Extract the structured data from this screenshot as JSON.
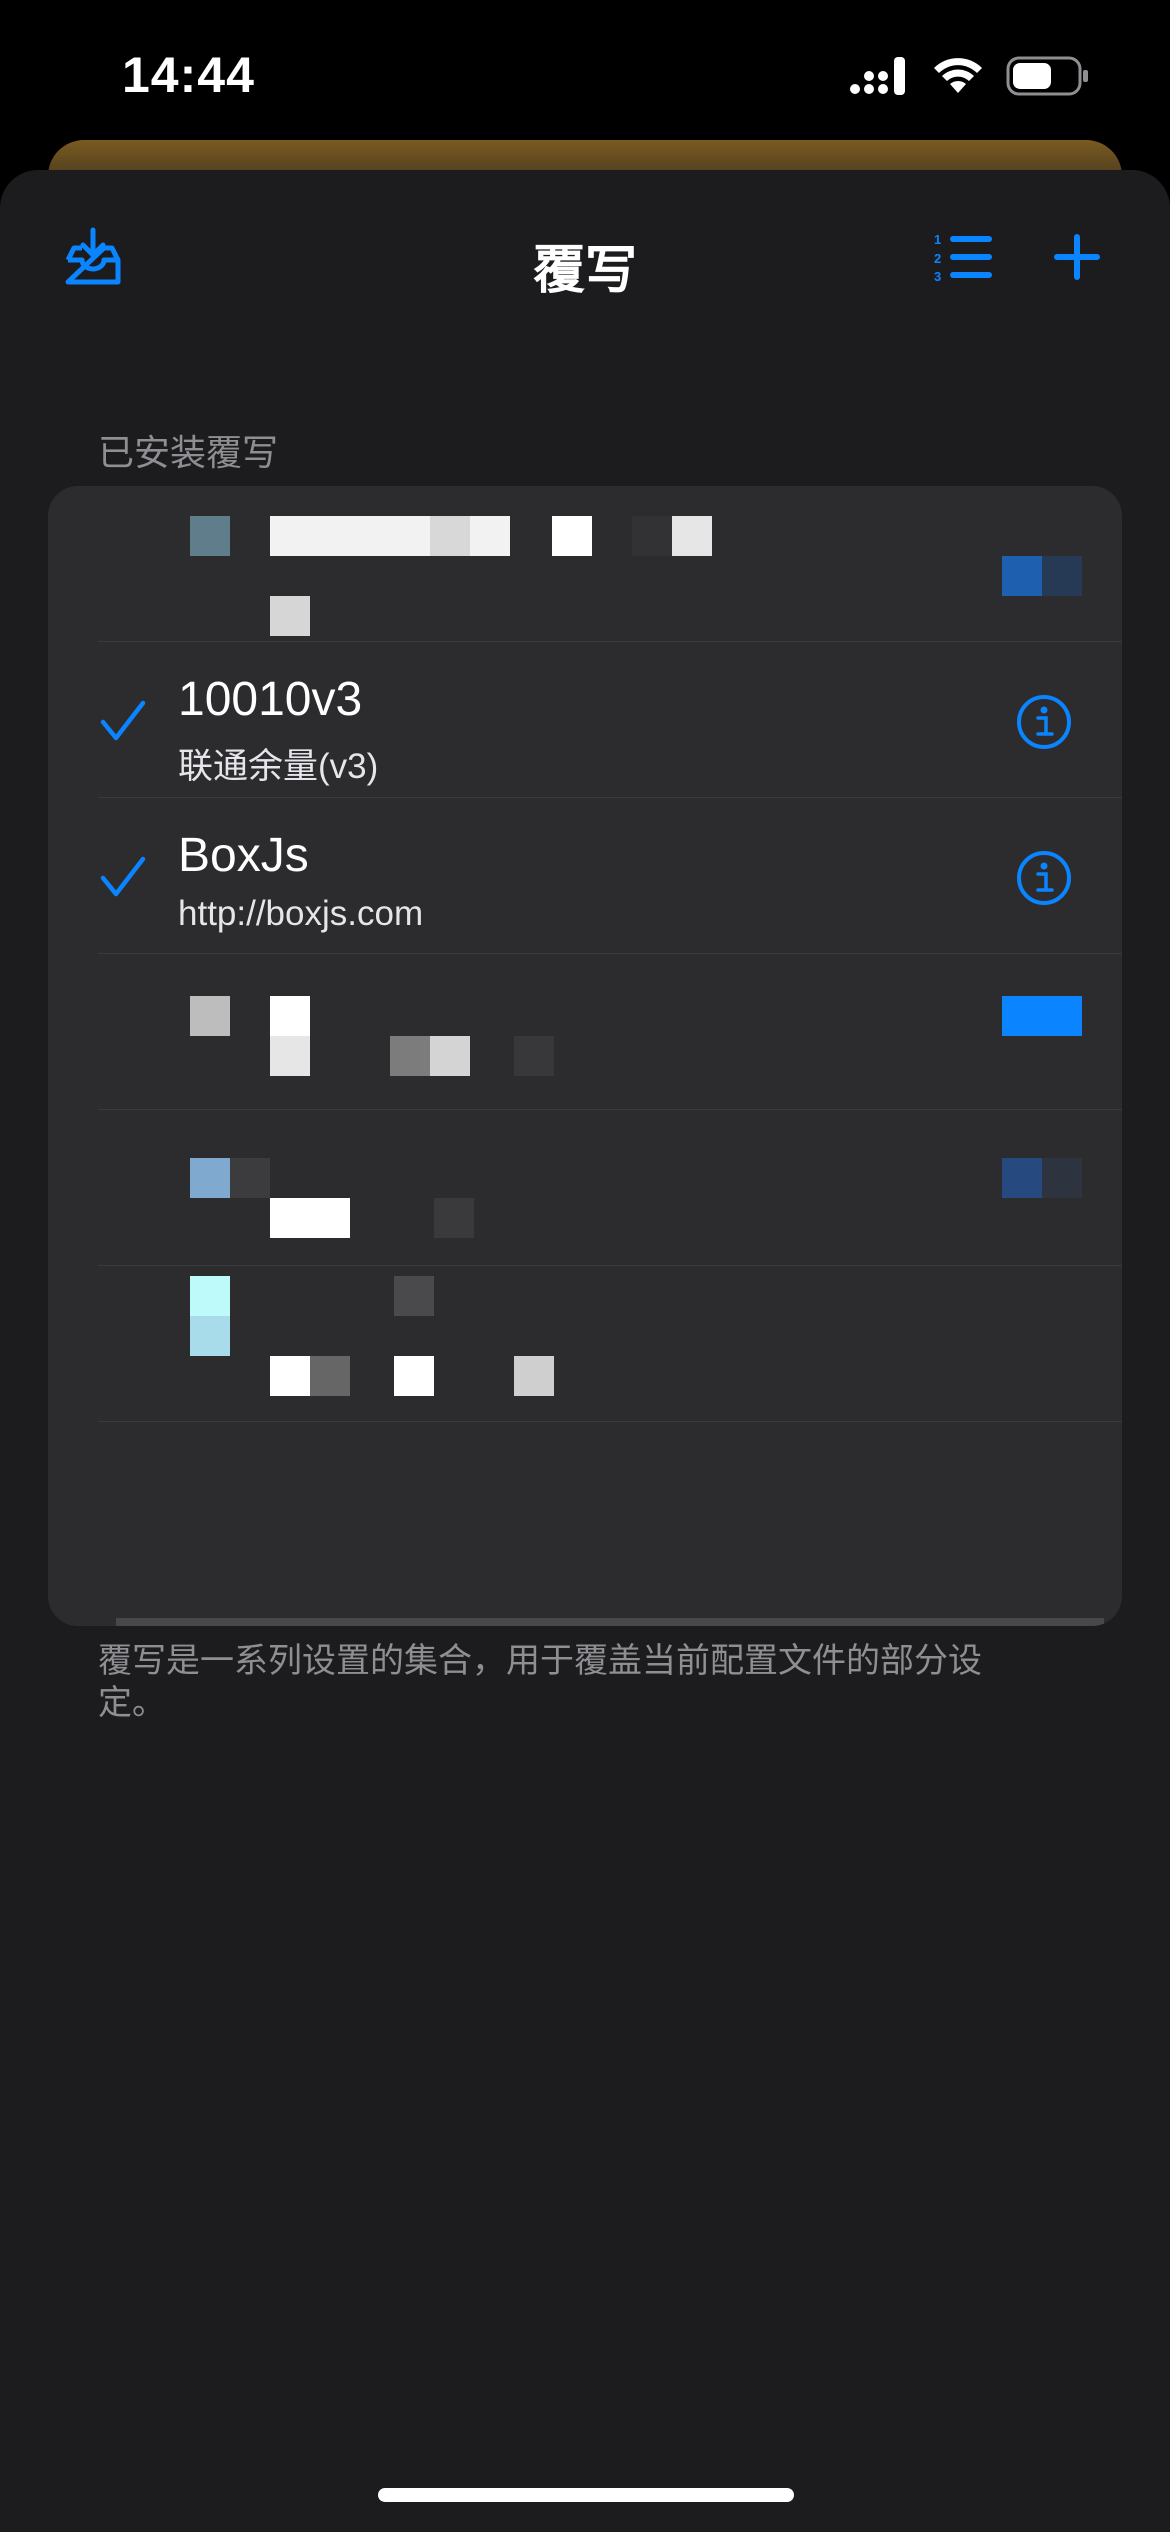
{
  "status_bar": {
    "time": "14:44"
  },
  "nav": {
    "title": "覆写"
  },
  "section": {
    "header": "已安装覆写"
  },
  "overrides": [
    {
      "title": "10010v3",
      "subtitle": "联通余量(v3)"
    },
    {
      "title": "BoxJs",
      "subtitle": "http://boxjs.com"
    }
  ],
  "footer": {
    "text": "覆写是一系列设置的集合，用于覆盖当前配置文件的部分设定。"
  },
  "colors": {
    "accent": "#0a84ff",
    "background": "#1c1c1e",
    "cell": "#2c2c2e"
  },
  "icons": {
    "import": "tray-download-icon",
    "sort": "numbered-list-icon",
    "add": "plus-icon",
    "check": "checkmark-icon",
    "info": "info-circle-icon"
  }
}
